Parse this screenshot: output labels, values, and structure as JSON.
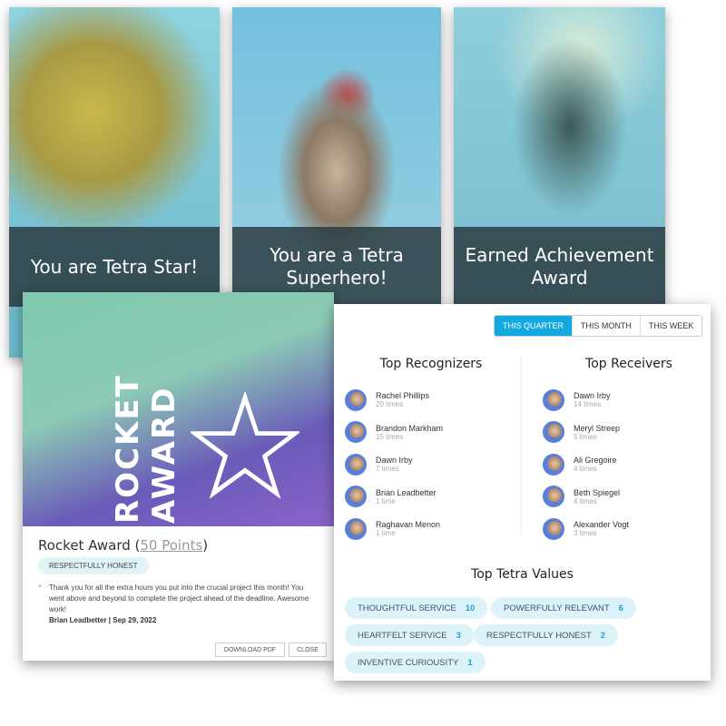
{
  "cards": [
    {
      "title": "You are Tetra Star!"
    },
    {
      "title": "You are a Tetra Superhero!"
    },
    {
      "title": "Earned Achievement Award"
    }
  ],
  "rocket": {
    "banner": "ROCKET AWARD",
    "name": "Rocket Award",
    "points": "50 Points",
    "value_tag": "RESPECTFULLY HONEST",
    "quote_mark": "“",
    "message": "Thank you for all the extra hours you put into the crucial project this month! You went above and beyond to complete the project ahead of the deadline. Awesome work!",
    "author_line": "Brian Leadbetter | Sep 29, 2022",
    "download_label": "DOWNLOAD PDF",
    "close_label": "CLOSE"
  },
  "stats": {
    "periods": [
      "THIS QUARTER",
      "THIS MONTH",
      "THIS WEEK"
    ],
    "active_period": "THIS QUARTER",
    "accent": "#13a9e0",
    "recognizers_title": "Top Recognizers",
    "recognizers": [
      {
        "name": "Rachel Phillips",
        "count": "20 times"
      },
      {
        "name": "Brandon Markham",
        "count": "15 times"
      },
      {
        "name": "Dawn Irby",
        "count": "7 times"
      },
      {
        "name": "Brian Leadbetter",
        "count": "1 time"
      },
      {
        "name": "Raghavan Menon",
        "count": "1 time"
      }
    ],
    "receivers_title": "Top Receivers",
    "receivers": [
      {
        "name": "Dawn Irby",
        "count": "14 times"
      },
      {
        "name": "Meryl Streep",
        "count": "5 times"
      },
      {
        "name": "Ali Gregoire",
        "count": "4 times"
      },
      {
        "name": "Beth Spiegel",
        "count": "4 times"
      },
      {
        "name": "Alexander Vogt",
        "count": "3 times"
      }
    ],
    "values_title": "Top Tetra Values",
    "values": [
      {
        "label": "THOUGHTFUL SERVICE",
        "count": "10"
      },
      {
        "label": "POWERFULLY RELEVANT",
        "count": "6"
      },
      {
        "label": "HEARTFELT SERVICE",
        "count": "3"
      },
      {
        "label": "RESPECTFULLY HONEST",
        "count": "2"
      },
      {
        "label": "INVENTIVE CURIOUSITY",
        "count": "1"
      }
    ]
  }
}
